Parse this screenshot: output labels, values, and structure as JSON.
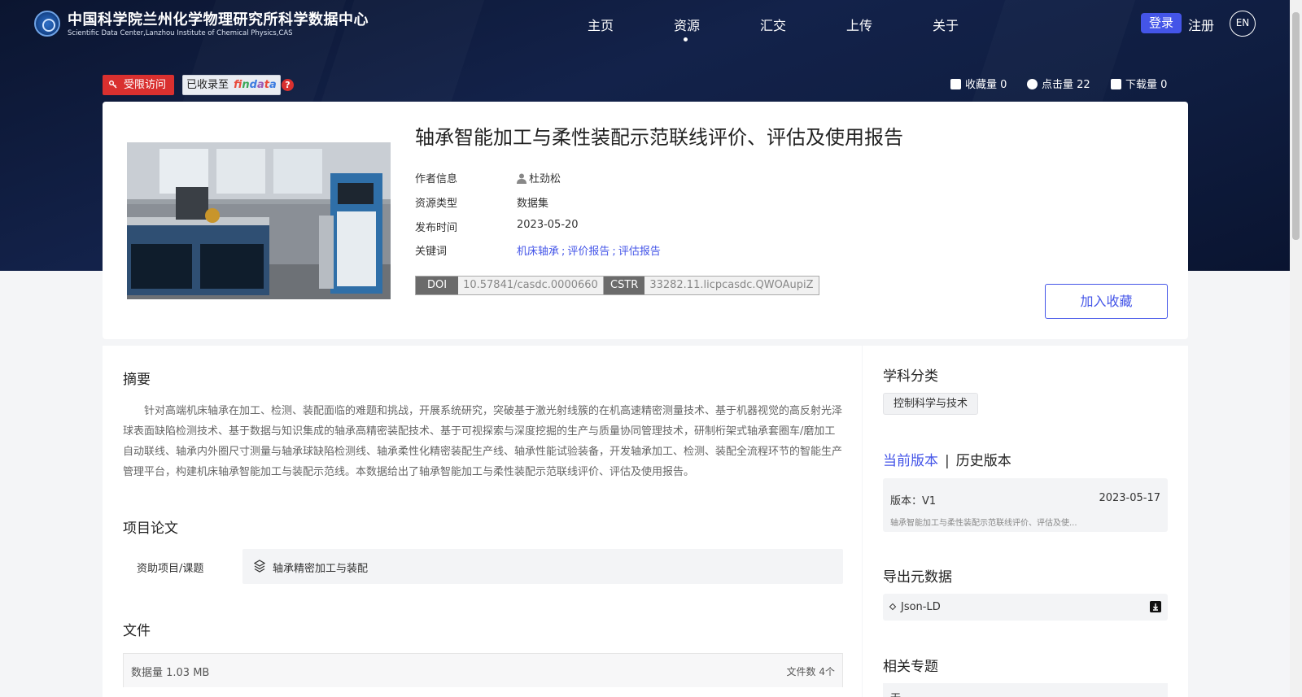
{
  "header": {
    "site_title": "中国科学院兰州化学物理研究所科学数据中心",
    "site_subtitle": "Scientific Data Center,Lanzhou Institute of Chemical Physics,CAS",
    "nav": [
      "主页",
      "资源",
      "汇交",
      "上传",
      "关于"
    ],
    "active_nav": "资源",
    "login": "登录",
    "register": "注册",
    "lang": "EN"
  },
  "badges": {
    "restricted": "受限访问",
    "indexed_prefix": "已收录至",
    "findata": "findata",
    "help": "?"
  },
  "stats": {
    "favorites": "收藏量 0",
    "views": "点击量 22",
    "downloads": "下载量 0"
  },
  "resource": {
    "title": "轴承智能加工与柔性装配示范联线评价、评估及使用报告",
    "author_label": "作者信息",
    "author": "杜劲松",
    "type_label": "资源类型",
    "type": "数据集",
    "date_label": "发布时间",
    "date": "2023-05-20",
    "keywords_label": "关键词",
    "keywords": [
      "机床轴承",
      "评价报告",
      "评估报告"
    ],
    "keyword_sep": ";",
    "doi_label": "DOI",
    "doi": "10.57841/casdc.0000660",
    "cstr_label": "CSTR",
    "cstr": "33282.11.licpcasdc.QWOAupiZ",
    "collect_button": "加入收藏"
  },
  "abstract": {
    "title": "摘要",
    "text": "针对高端机床轴承在加工、检测、装配面临的难题和挑战，开展系统研究，突破基于激光射线簇的在机高速精密测量技术、基于机器视觉的高反射光泽球表面缺陷检测技术、基于数据与知识集成的轴承高精密装配技术、基于可视探索与深度挖掘的生产与质量协同管理技术，研制桁架式轴承套圈车/磨加工自动联线、轴承内外圈尺寸测量与轴承球缺陷检测线、轴承柔性化精密装配生产线、轴承性能试验装备，开发轴承加工、检测、装配全流程环节的智能生产管理平台，构建机床轴承智能加工与装配示范线。本数据给出了轴承智能加工与柔性装配示范联线评价、评估及使用报告。"
  },
  "project": {
    "title": "项目论文",
    "fund_label": "资助项目/课题",
    "fund_value": "轴承精密加工与装配"
  },
  "files": {
    "title": "文件",
    "size": "数据量 1.03 MB",
    "count": "文件数 4个"
  },
  "sidebar": {
    "subject_title": "学科分类",
    "subject": "控制科学与技术",
    "version_current": "当前版本",
    "version_sep": "|",
    "version_history": "历史版本",
    "version_label": "版本：V1",
    "version_date": "2023-05-17",
    "version_desc": "轴承智能加工与柔性装配示范联线评价、评估及使...",
    "export_title": "导出元数据",
    "export_format": "Json-LD",
    "related_title": "相关专题",
    "related_value": "无"
  },
  "colors": {
    "accent": "#4455e8",
    "restricted": "#d9302f",
    "header_bg": "#13224a"
  }
}
